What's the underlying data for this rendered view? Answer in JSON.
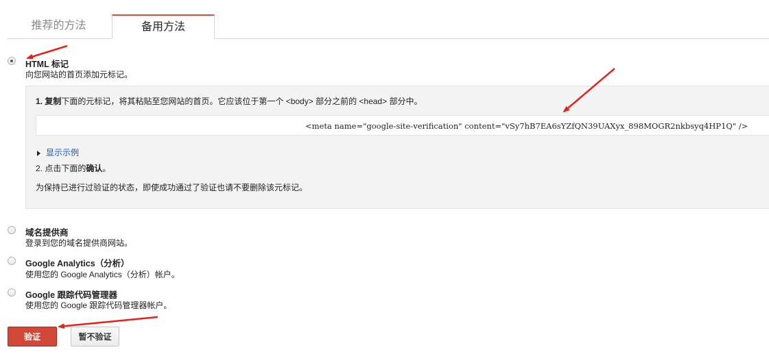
{
  "tabs": [
    {
      "label": "推荐的方法",
      "active": false
    },
    {
      "label": "备用方法",
      "active": true
    }
  ],
  "options": [
    {
      "title": "HTML 标记",
      "desc": "向您网站的首页添加元标记。",
      "selected": true
    },
    {
      "title": "域名提供商",
      "desc": "登录到您的域名提供商网站。",
      "selected": false
    },
    {
      "title": "Google Analytics（分析）",
      "desc": "使用您的 Google Analytics（分析）帐户。",
      "selected": false
    },
    {
      "title": "Google 跟踪代码管理器",
      "desc": "使用您的 Google 跟踪代码管理器帐户。",
      "selected": false
    }
  ],
  "instructions": {
    "step1_num": "1. ",
    "step1_bold": "复制",
    "step1_text": "下面的元标记，将其粘贴至您网站的首页。它应该位于第一个 <body> 部分之前的 <head> 部分中。",
    "meta_tag": "<meta name=\"google-site-verification\" content=\"vSy7hB7EA6sYZfQN39UAXyx_898MOGR2nkbsyq4HP1Q\" />",
    "show_example": "显示示例",
    "step2_prefix": "2. 点击下面的",
    "step2_bold": "确认",
    "step2_suffix": "。",
    "note": "为保持已进行过验证的状态，即使成功通过了验证也请不要删除该元标记。"
  },
  "buttons": {
    "verify": "验证",
    "skip": "暂不验证"
  },
  "colors": {
    "accent": "#dd4b39",
    "verify_button": "#d14836",
    "link": "#1155cc",
    "annotation_arrow": "#e8201a"
  }
}
